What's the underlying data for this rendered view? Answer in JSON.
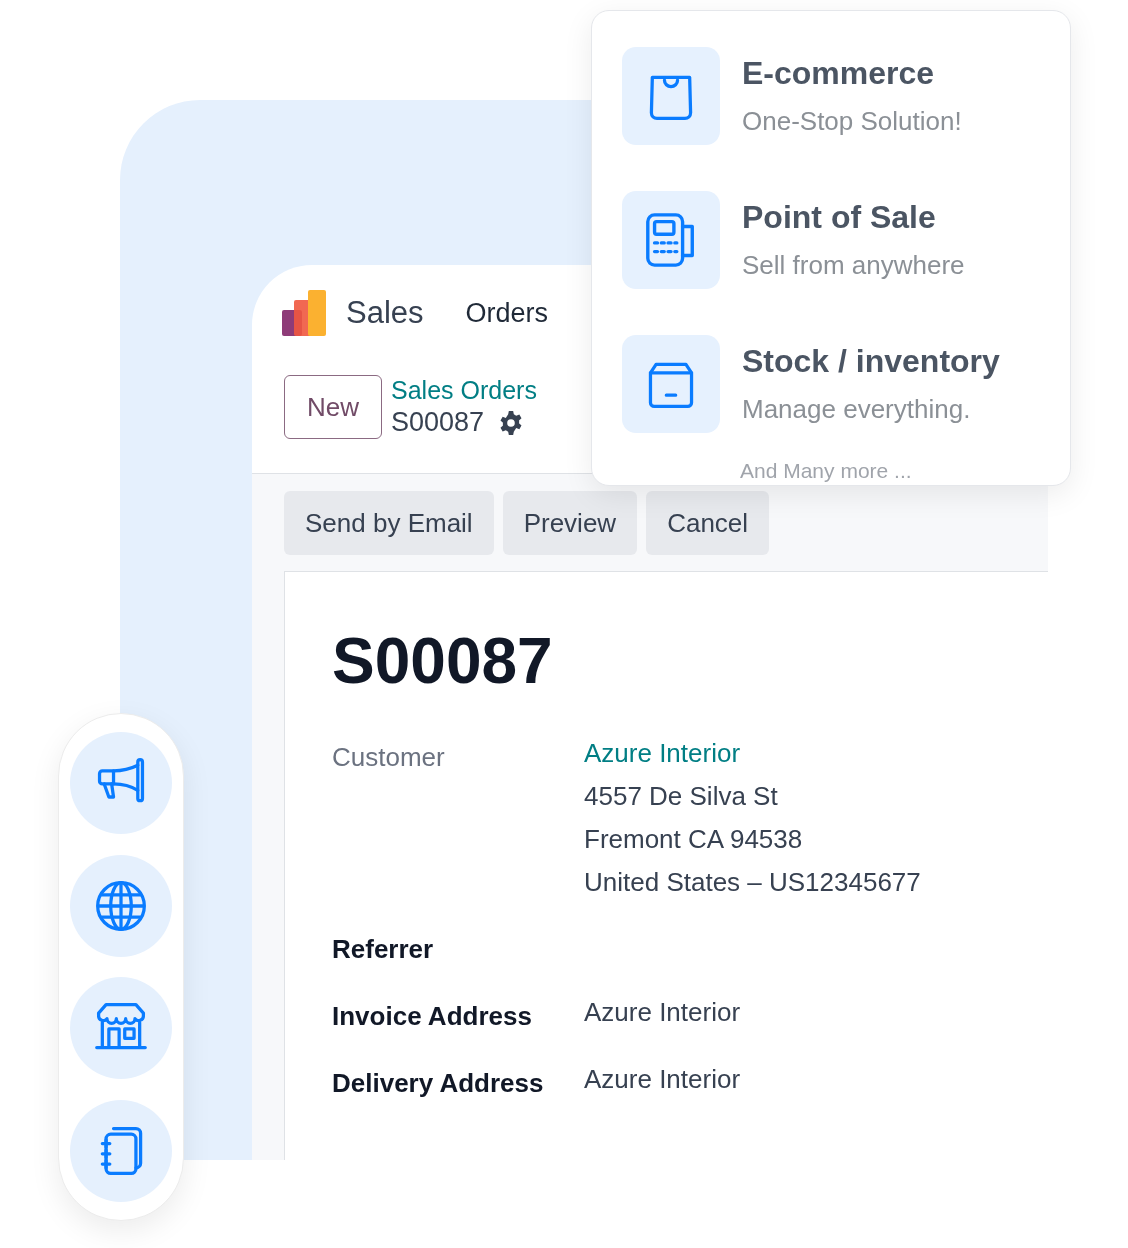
{
  "app": {
    "name": "Sales",
    "menu": [
      "Orders"
    ]
  },
  "control_panel": {
    "new_button": "New",
    "breadcrumb": "Sales Orders",
    "record": "S00087"
  },
  "actions": [
    "Send by Email",
    "Preview",
    "Cancel"
  ],
  "form": {
    "title": "S00087",
    "fields": [
      {
        "label": "Customer",
        "kind": "partner",
        "link": "Azure Interior",
        "lines": [
          "4557 De Silva St",
          "Fremont CA 94538",
          "United States – US12345677"
        ]
      },
      {
        "label": "Referrer",
        "kind": "text"
      },
      {
        "label": "Invoice Address",
        "kind": "text",
        "value": "Azure Interior"
      },
      {
        "label": "Delivery Address",
        "kind": "text",
        "value": "Azure Interior"
      }
    ]
  },
  "features": {
    "items": [
      {
        "title": "E-commerce",
        "subtitle": "One-Stop Solution!"
      },
      {
        "title": "Point of Sale",
        "subtitle": "Sell from anywhere"
      },
      {
        "title": "Stock / inventory",
        "subtitle": "Manage everything."
      }
    ],
    "footer": "And Many more ..."
  }
}
